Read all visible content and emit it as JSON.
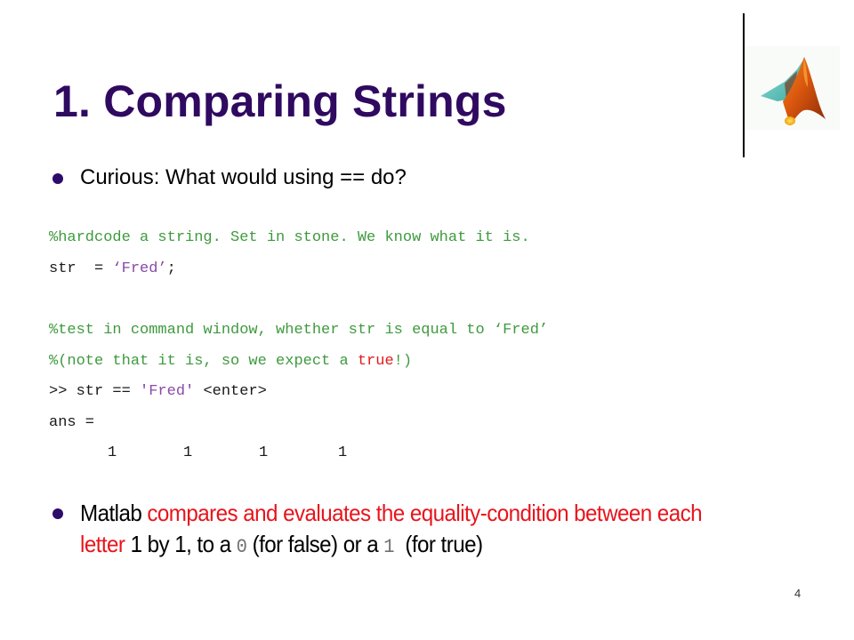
{
  "slide": {
    "title": "1. Comparing Strings",
    "page_number": "4",
    "logo": {
      "icon": "matlab-membrane-logo",
      "colors": {
        "teal": "#5fc8c0",
        "orange": "#d9560e",
        "yellow": "#f5c20a",
        "dark": "#7a2a08"
      }
    },
    "colors": {
      "title": "#2f0a60",
      "bullet": "#2d0b6b",
      "emphasis_red": "#e8141c",
      "comment_green": "#3e9a3e",
      "string_purple": "#8a4aa6"
    }
  },
  "bullets": [
    {
      "text": "Curious: What would using == do?"
    },
    {
      "segments": {
        "lead": "Matlab ",
        "red": "compares and evaluates the equality-condition between each letter",
        "mid": " 1 by 1, to a ",
        "zero": "0",
        "false_text": " (for false) or a ",
        "one": "1",
        "tail": "  (for true)"
      }
    }
  ],
  "code": {
    "line1_comment": "%hardcode a string. Set in stone. We know what it is.",
    "line2_prefix": "str  = ",
    "line2_string": "‘Fred’",
    "line2_suffix": ";",
    "line3_comment": "%test in command window, whether str is equal to ‘Fred’",
    "line4_prefix": "%(note that it is, so we expect a ",
    "line4_true": "true",
    "line4_suffix": "!)",
    "line5_prompt": ">> str == ",
    "line5_string": "'Fred'",
    "line5_suffix": " <enter>",
    "line6": "ans =",
    "answer_values": [
      "1",
      "1",
      "1",
      "1"
    ]
  }
}
